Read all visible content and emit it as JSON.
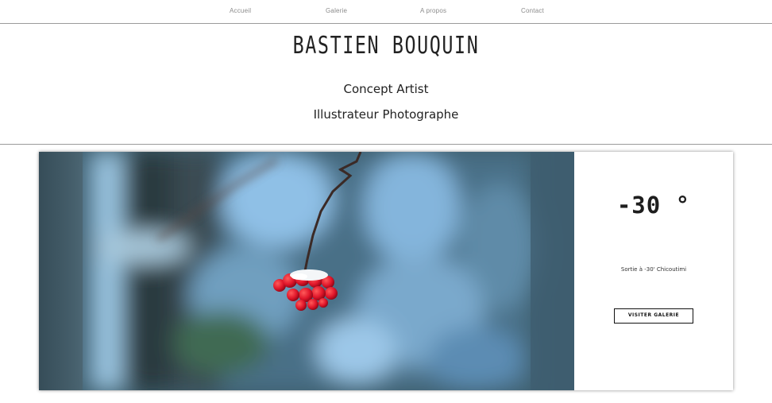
{
  "nav": {
    "items": [
      {
        "label": "Accueil"
      },
      {
        "label": "Galerie"
      },
      {
        "label": "A propos"
      },
      {
        "label": "Contact"
      }
    ]
  },
  "header": {
    "title": "BASTIEN BOUQUIN",
    "subtitle_1": "Concept Artist",
    "subtitle_2": "Illustrateur Photographe"
  },
  "feature": {
    "temperature": "-30 °",
    "caption": "Sortie à -30' Chicoutimi",
    "button_label": "VISITER GALERIE"
  },
  "colors": {
    "text": "#222222",
    "nav_text": "#8b8b8b",
    "divider": "#9a9a9a",
    "berry_red": "#e0162a",
    "sky_blue": "#7fb1d9"
  }
}
